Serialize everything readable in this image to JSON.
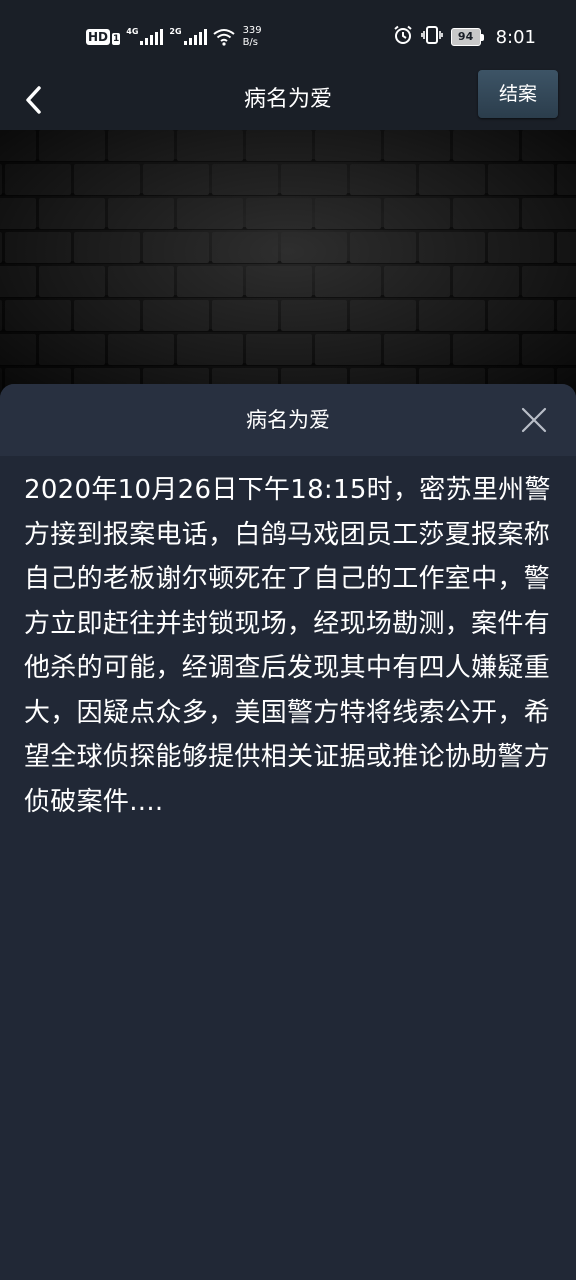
{
  "status_bar": {
    "hd_label": "HD",
    "hd_sub": "1",
    "sim1_network": "4G",
    "sim2_network": "2G",
    "speed_value": "339",
    "speed_unit": "B/s",
    "battery_level": "94",
    "time": "8:01",
    "icons": [
      "hd-icon",
      "signal-icon",
      "signal-icon",
      "wifi-icon",
      "alarm-icon",
      "vibrate-icon",
      "battery-icon"
    ]
  },
  "nav": {
    "back_icon": "chevron-left-icon",
    "title": "病名为爱",
    "close_case_label": "结案"
  },
  "sheet": {
    "title": "病名为爱",
    "close_icon": "close-icon",
    "body": "2020年10月26日下午18:15时，密苏里州警方接到报案电话，白鸽马戏团员工莎夏报案称自己的老板谢尔顿死在了自己的工作室中，警方立即赶往并封锁现场，经现场勘测，案件有他杀的可能，经调查后发现其中有四人嫌疑重大，因疑点众多，美国警方特将线索公开，希望全球侦探能够提供相关证据或推论协助警方侦破案件...."
  },
  "colors": {
    "page_bg": "#1f2632",
    "header_bg": "#1a1f27",
    "sheet_bg": "#212836",
    "sheet_header_bg": "#283040",
    "button_bg": "#34495a",
    "text": "#ffffff"
  }
}
